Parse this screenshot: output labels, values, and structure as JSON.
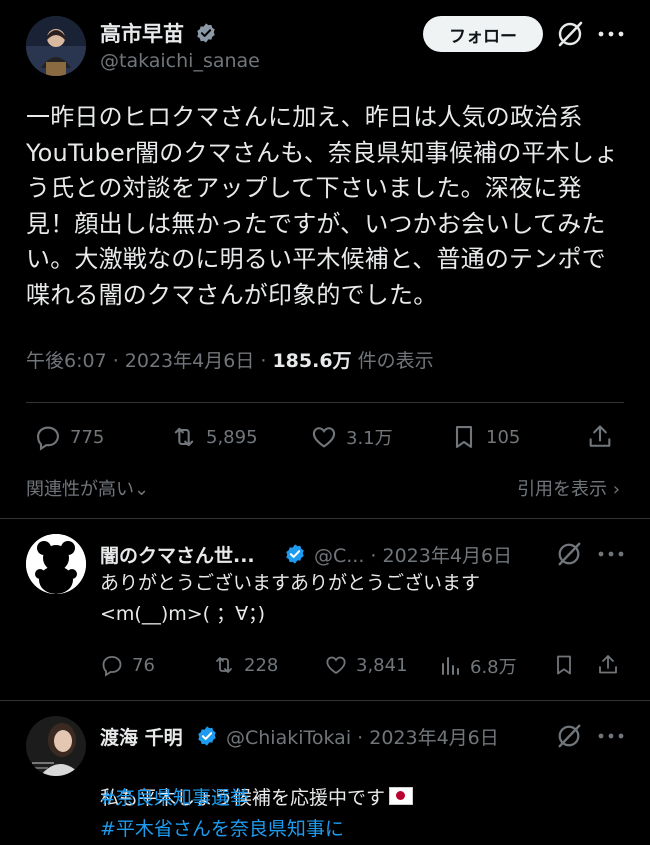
{
  "main_tweet": {
    "author_name": "高市早苗",
    "author_handle": "@takaichi_sanae",
    "follow_label": "フォロー",
    "text": "一昨日のヒロクマさんに加え、昨日は人気の政治系\nYouTuber闇のクマさんも、奈良県知事候補の平木しょ\nう氏との対談をアップして下さいました。深夜に発\n見！顔出しは無かったですが、いつかお会いしてみた\nい。大激戦なのに明るい平木候補と、普通のテンポで\n喋れる闇のクマさんが印象的でした。",
    "timestamp": "午後6:07 · 2023年4月6日 · ",
    "views_count": "185.6万",
    "views_label": " 件の表示",
    "replies": "775",
    "reposts": "5,895",
    "likes": "3.1万",
    "bookmarks": "105"
  },
  "sort": {
    "label": "関連性が高い",
    "chevron": "⌄"
  },
  "quotes": {
    "label": "引用を表示",
    "chevron": "›"
  },
  "replies": [
    {
      "author_name": "闇のクマさん世...",
      "author_handle": "@C...",
      "date": " · 2023年4月6日",
      "text": "ありがとうございますありがとうございます\n<m(__)m>( ；∀；)",
      "replies": "76",
      "reposts": "228",
      "likes": "3,841",
      "views": "6.8万"
    },
    {
      "author_name": "渡海 千明",
      "author_handle": "@ChiakiTokai",
      "date": " · 2023年4月6日",
      "text": "私も平木しょう候補を応援中です",
      "hashtags": [
        "#奈良県知事選挙",
        "#平木省さんを奈良県知事に"
      ]
    }
  ],
  "colors": {
    "background": "#000000",
    "text": "#e7e9ea",
    "muted": "#71767b",
    "verified": "#1d9bf0",
    "hashtag": "#1d9bf0",
    "divider": "#2f3336"
  }
}
